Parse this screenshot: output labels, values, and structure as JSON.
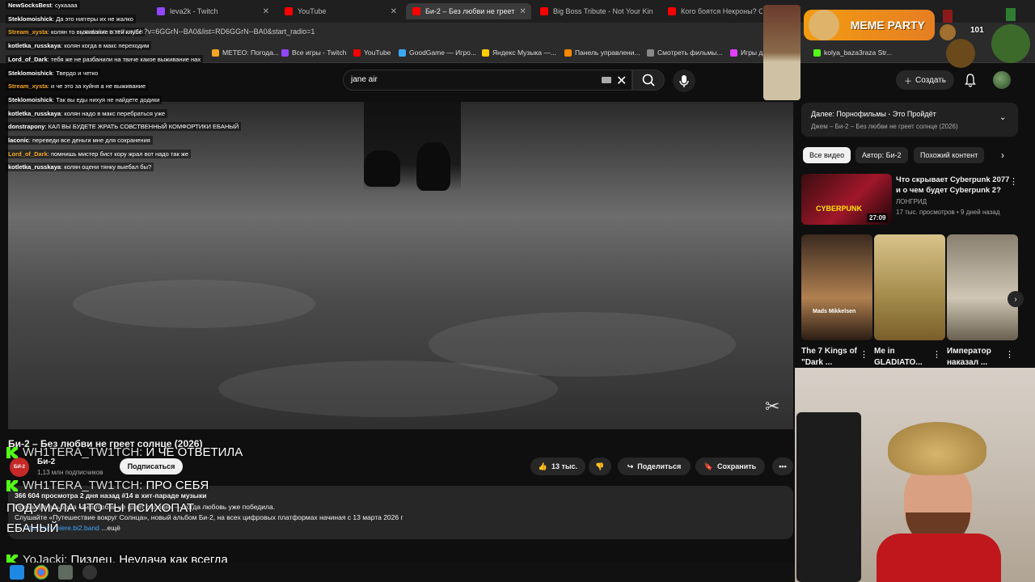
{
  "browser": {
    "tabs": [
      {
        "label": "",
        "color": "#9146ff"
      },
      {
        "label": "leva2k - Twitch",
        "color": "#9146ff"
      },
      {
        "label": "YouTube",
        "color": "#ff0000"
      },
      {
        "label": "Би-2 – Без любви не греет",
        "color": "#ff0000"
      },
      {
        "label": "Big Boss Tribute - Not Your Kin",
        "color": "#ff0000"
      },
      {
        "label": "Кого боятся Некроны? Спой",
        "color": "#ff0000"
      }
    ],
    "url": "youtube.com/watch?v=6GGrN--BA0&list=RD6GGrN--BA0&start_radio=1",
    "bookmarks": [
      {
        "label": "METEO: Погода...",
        "color": "#f5a623"
      },
      {
        "label": "Все игры - Twitch",
        "color": "#9146ff"
      },
      {
        "label": "YouTube",
        "color": "#ff0000"
      },
      {
        "label": "GoodGame — Игро...",
        "color": "#3aa9f5"
      },
      {
        "label": "Яндекс Музыка —...",
        "color": "#ffcc00"
      },
      {
        "label": "Панель управлени...",
        "color": "#ff8800"
      },
      {
        "label": "Смотреть фильмы...",
        "color": "#888888"
      },
      {
        "label": "Игры для",
        "color": "#e040fb"
      },
      {
        "label": "kolya_baza3raza Str...",
        "color": "#53fc18"
      }
    ]
  },
  "header": {
    "search_value": "jane air",
    "create_label": "Создать"
  },
  "video": {
    "title": "Би-2 – Без любви не греет солнце (2026)",
    "channel": "Би-2",
    "channel_avatar_text": "БИ-2",
    "subs": "1,13 млн подписчиков",
    "subscribe_label": "Подписаться",
    "likes": "13 тыс.",
    "share_label": "Поделиться",
    "save_label": "Сохранить",
    "stats": "366 604 просмотра  2 дня назад  #14 в хит-параде музыки",
    "desc1": "Премьера альбома «Без любви не греет солнце» — когда любовь уже победила.",
    "desc2": "Слушайте «Путешествие вокруг Солнца», новый альбом Би-2, на всех цифровых платформах начиная с 13 марта 2026 г",
    "desc3_prefix": "→ ",
    "desc3_link": "https://premiere.bi2.band",
    "more": "...ещё"
  },
  "sidebar": {
    "mix_title": "Далее: Порнофильмы - Это Пройдёт",
    "mix_sub": "Джем – Би-2 – Без любви не греет солнце (2026)",
    "chips": [
      "Все видео",
      "Автор: Би-2",
      "Похожий контент"
    ],
    "rec": {
      "title": "Что скрывает Cyberpunk 2077 и о чем будет Cyberpunk 2?",
      "channel": "ЛОНГРИД",
      "meta": "17 тыс. просмотров • 9 дней назад",
      "duration": "27:09",
      "thumb_text": "CYBERPUNK"
    },
    "shorts": [
      {
        "title": "The 7 Kings of \"Dark ...",
        "overlay": "Mads Mikkelsen"
      },
      {
        "title": "Me in GLADIATO...",
        "overlay": ""
      },
      {
        "title": "Император наказал ...",
        "overlay": ""
      }
    ]
  },
  "chat": [
    {
      "user": "NewSocksBest",
      "color": "#ffffff",
      "msg": "сукаааа"
    },
    {
      "user": "Steklomoishick",
      "color": "#ffffff",
      "msg": "Да это ниггеры их не жалко"
    },
    {
      "user": "Stream_xysta",
      "color": "#f5a623",
      "msg": "колян то выживание в тей клубе"
    },
    {
      "user": "kotletka_russkaya",
      "color": "#ffffff",
      "msg": "колян когда в макс переходим"
    },
    {
      "user": "Lord_of_Dark",
      "color": "#ffffff",
      "msg": "тебя же не разбанили на твиче какое выживание нах"
    },
    {
      "user": "Steklomoishick",
      "color": "#ffffff",
      "msg": "Твердо и четко"
    },
    {
      "user": "Stream_xysta",
      "color": "#f5a623",
      "msg": "и че это за хуйня а не выживание"
    },
    {
      "user": "Steklomoishick",
      "color": "#ffffff",
      "msg": "Так вы еды нихуя не найдете додики"
    },
    {
      "user": "kotletka_russkaya",
      "color": "#ffffff",
      "msg": "колян надо в макс перебраться уже"
    },
    {
      "user": "donstrapony",
      "color": "#ffffff",
      "msg": "КАЛ ВЫ БУДЕТЕ ЖРАТЬ СОВСТВЕННЫЙ КОМФОРТИКИ ЕБАНЫЙ"
    },
    {
      "user": "laconic",
      "color": "#ffffff",
      "msg": "переведи все деньги мне для сохранения"
    },
    {
      "user": "Lord_of_Dark",
      "color": "#f5a623",
      "msg": "помнишь мистер бист кору жрал вот надо так же"
    },
    {
      "user": "kotletka_russkaya",
      "color": "#ffffff",
      "msg": "колян оцени тянку выебал бы?"
    }
  ],
  "big_chat": [
    {
      "user": "WH1TERA_TW1TCH:",
      "msg": "И ЧЕ ОТВЕТИЛА"
    },
    {
      "user": "WH1TERA_TW1TCH:",
      "msg": "ПРО СЕБЯ"
    },
    {
      "user": "",
      "msg": "ПОДУМАЛА ЧТО ТЫ ПСИХОПАТ"
    },
    {
      "user": "",
      "msg": "ЕБАНЫЙ"
    },
    {
      "user": "YoJacki:",
      "msg": "Пиздец. Неудача как всегда"
    }
  ],
  "overlay": {
    "meme": "MEME PARTY",
    "medal_count": "101"
  }
}
